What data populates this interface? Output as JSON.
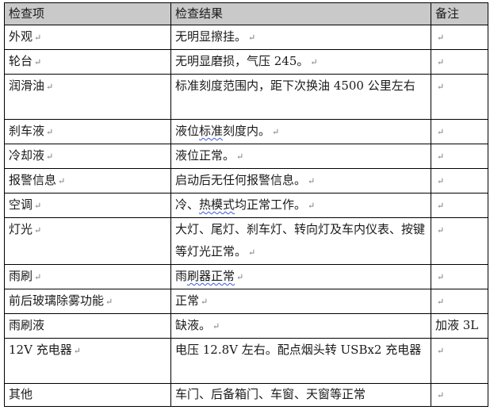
{
  "table": {
    "headers": {
      "item": "检查项",
      "result": "检查结果",
      "note": "备注"
    },
    "return_mark": "↵",
    "rows": [
      {
        "item": "外观",
        "result": "无明显擦挂。",
        "note": ""
      },
      {
        "item": "轮台",
        "result": "无明显磨损，气压 245。",
        "note": ""
      },
      {
        "item": "润滑油",
        "result": "标准刻度范围内，距下次换油 4500 公里左右",
        "note": ""
      },
      {
        "item": "刹车液",
        "result_prefix": "液位",
        "result_highlight": "标准",
        "result_suffix": "刻度内。",
        "note": ""
      },
      {
        "item": "冷却液",
        "result": "液位正常。",
        "note": ""
      },
      {
        "item": "报警信息",
        "result": "启动后无任何报警信息。",
        "note": ""
      },
      {
        "item": "空调",
        "result_prefix": "冷、",
        "result_highlight": "热模式",
        "result_suffix": "均正常工作。",
        "note": ""
      },
      {
        "item": "灯光",
        "result": "大灯、尾灯、刹车灯、转向灯及车内仪表、按键等灯光正常。",
        "note": ""
      },
      {
        "item": "雨刷",
        "result_prefix": "雨",
        "result_highlight": "刷器正常",
        "result_suffix": "",
        "note": ""
      },
      {
        "item": "前后玻璃除雾功能",
        "result": "正常",
        "note": ""
      },
      {
        "item": "雨刷液",
        "result": "缺液。",
        "note": "加液 3L"
      },
      {
        "item": "12V 充电器",
        "result": "电压 12.8V 左右。配点烟头转 USBx2 充电器",
        "note": ""
      },
      {
        "item": "其他",
        "result": "车门、后备箱门、车窗、天窗等正常",
        "note": ""
      }
    ]
  }
}
